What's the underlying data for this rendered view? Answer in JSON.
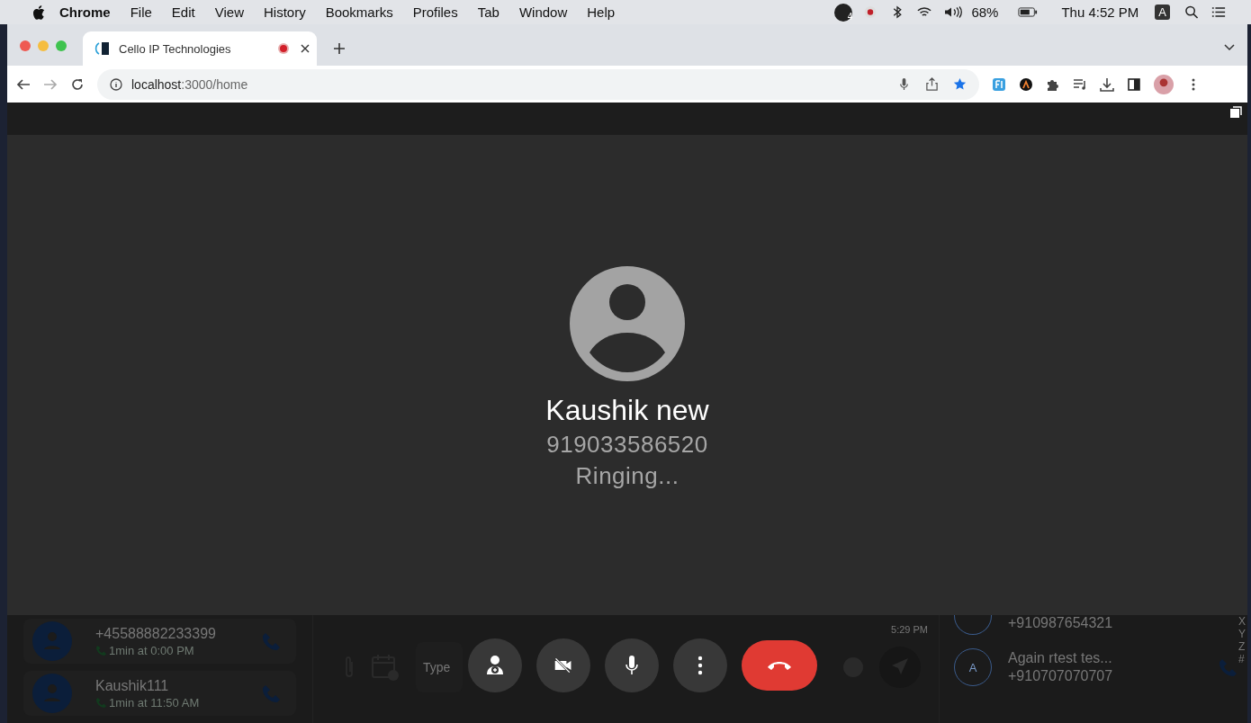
{
  "menubar": {
    "app": "Chrome",
    "items": [
      "File",
      "Edit",
      "View",
      "History",
      "Bookmarks",
      "Profiles",
      "Tab",
      "Window",
      "Help"
    ],
    "notification_count": "4",
    "battery": "68%",
    "clock": "Thu 4:52 PM",
    "input_source": "A"
  },
  "tab": {
    "title": "Cello IP Technologies"
  },
  "address": {
    "host": "localhost",
    "path": ":3000/home"
  },
  "call": {
    "name": "Kaushik new",
    "number": "919033586520",
    "status": "Ringing..."
  },
  "controls": [
    {
      "kind": "add-person"
    },
    {
      "kind": "video-off"
    },
    {
      "kind": "mic"
    },
    {
      "kind": "more"
    },
    {
      "kind": "end-call"
    }
  ],
  "background": {
    "contacts": [
      {
        "name": "+45588882233399",
        "detail": "1min at  0:00 PM"
      },
      {
        "name": "Kaushik111",
        "detail": "1min at  11:50 AM"
      }
    ],
    "composer": {
      "placeholder": "Type",
      "time": "5:29 PM"
    },
    "right_contacts": [
      {
        "number": "+910987654321"
      },
      {
        "initial": "A",
        "name": "Again rtest tes...",
        "number": "+910707070707"
      }
    ],
    "alphabet": [
      "X",
      "Y",
      "Z",
      "#"
    ]
  }
}
